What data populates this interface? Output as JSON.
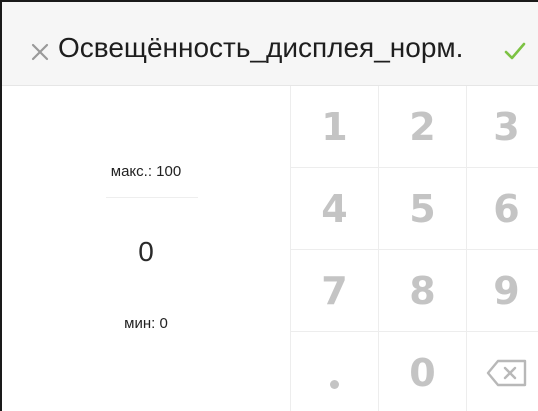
{
  "header": {
    "title": "Освещённость_дисплея_норм.",
    "close_icon": "close-icon",
    "confirm_icon": "checkmark-icon",
    "confirm_color": "#7cc243"
  },
  "range": {
    "max_label": "макс.: 100",
    "min_label": "мин: 0"
  },
  "input": {
    "value": "0"
  },
  "keypad": {
    "keys": [
      "1",
      "2",
      "3",
      "4",
      "5",
      "6",
      "7",
      "8",
      "9",
      ".",
      "0",
      "⌫"
    ],
    "dot_icon": "decimal-point-icon",
    "backspace_icon": "backspace-icon"
  }
}
